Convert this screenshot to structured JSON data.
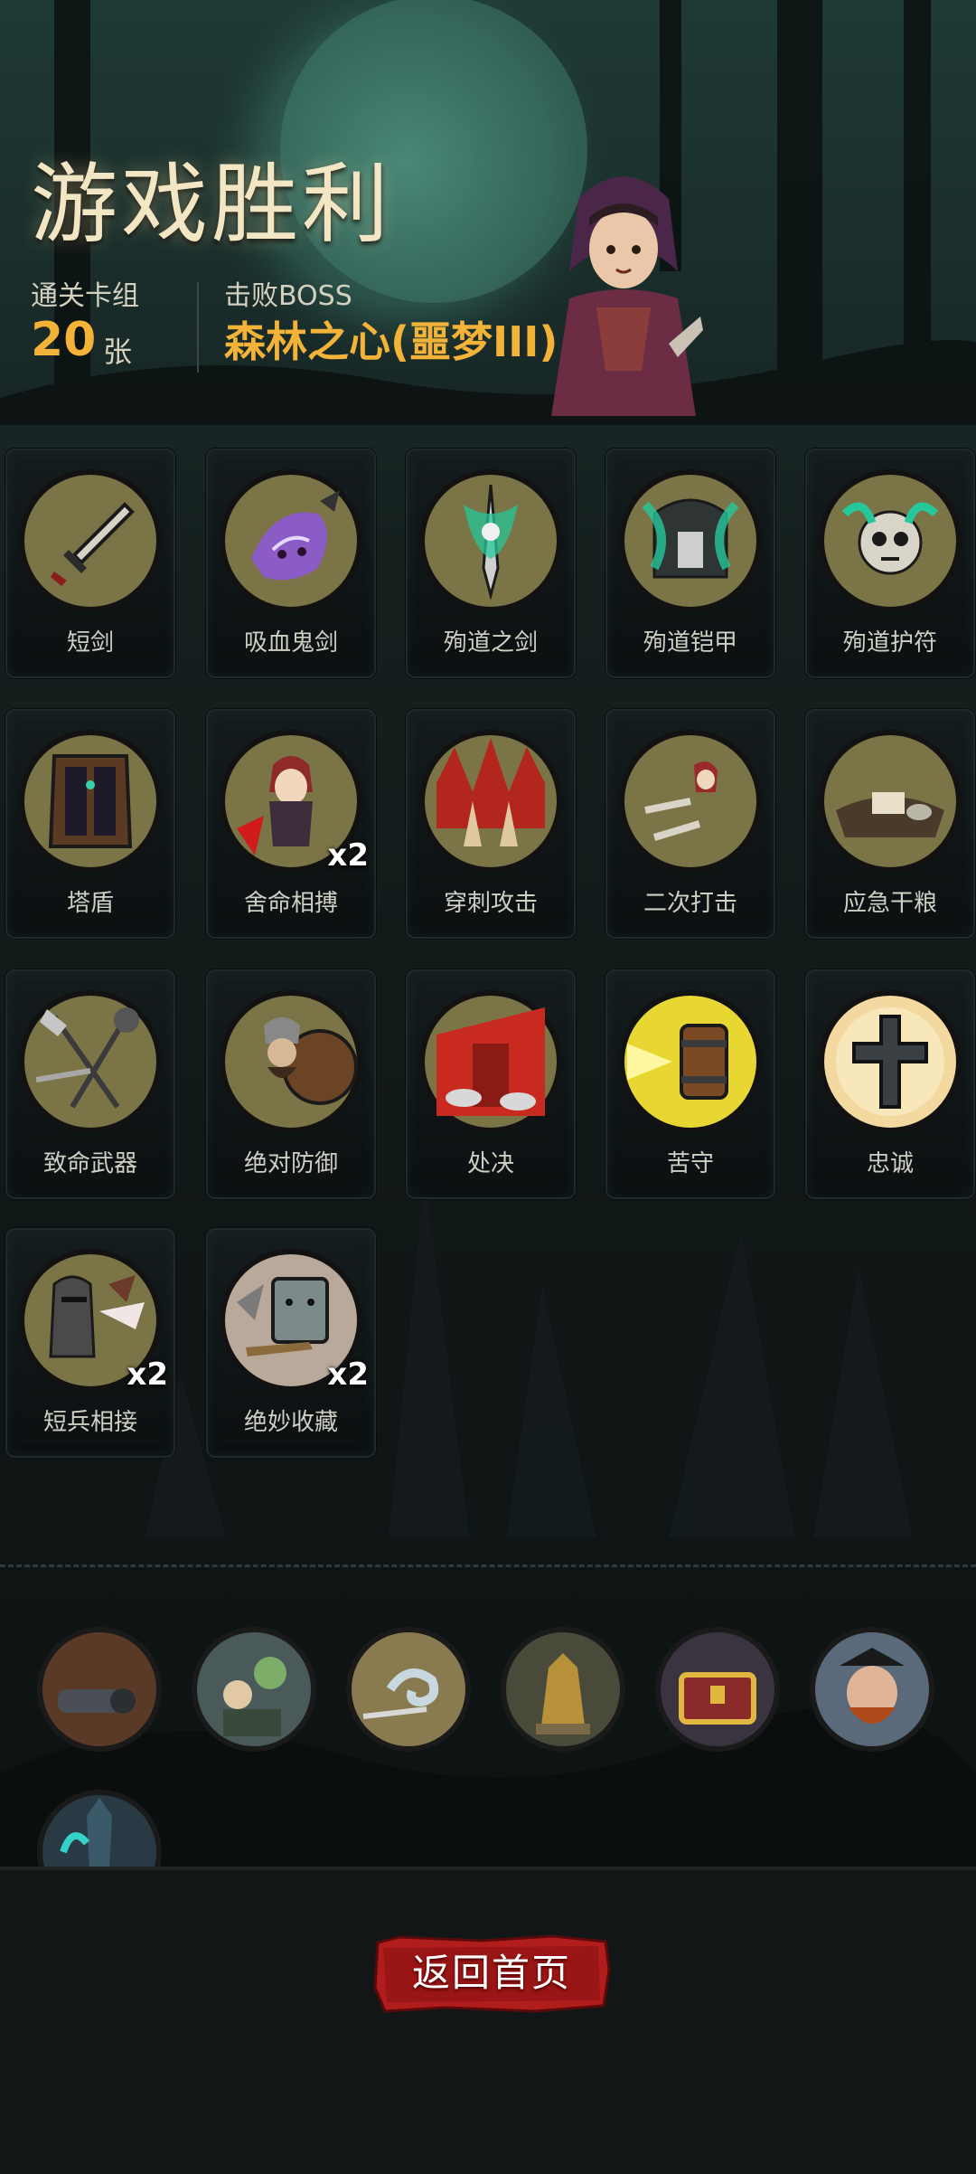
{
  "result": {
    "title": "游戏胜利",
    "deck_label": "通关卡组",
    "deck_count": "20",
    "deck_unit": "张",
    "boss_label": "击败BOSS",
    "boss_name": "森林之心(噩梦III)"
  },
  "cards": [
    {
      "name": "短剑",
      "multiplier": "",
      "icon": "dagger-icon"
    },
    {
      "name": "吸血鬼剑",
      "multiplier": "",
      "icon": "vampire-sword-icon"
    },
    {
      "name": "殉道之剑",
      "multiplier": "",
      "icon": "martyr-sword-icon"
    },
    {
      "name": "殉道铠甲",
      "multiplier": "",
      "icon": "martyr-armor-icon"
    },
    {
      "name": "殉道护符",
      "multiplier": "",
      "icon": "martyr-amulet-icon"
    },
    {
      "name": "塔盾",
      "multiplier": "",
      "icon": "tower-shield-icon"
    },
    {
      "name": "舍命相搏",
      "multiplier": "x2",
      "icon": "desperate-fight-icon"
    },
    {
      "name": "穿刺攻击",
      "multiplier": "",
      "icon": "pierce-attack-icon"
    },
    {
      "name": "二次打击",
      "multiplier": "",
      "icon": "double-strike-icon"
    },
    {
      "name": "应急干粮",
      "multiplier": "",
      "icon": "emergency-ration-icon"
    },
    {
      "name": "致命武器",
      "multiplier": "",
      "icon": "deadly-weapons-icon"
    },
    {
      "name": "绝对防御",
      "multiplier": "",
      "icon": "absolute-defense-icon"
    },
    {
      "name": "处决",
      "multiplier": "",
      "icon": "execute-icon"
    },
    {
      "name": "苦守",
      "multiplier": "",
      "icon": "hold-fast-icon"
    },
    {
      "name": "忠诚",
      "multiplier": "",
      "icon": "loyalty-cross-icon"
    },
    {
      "name": "短兵相接",
      "multiplier": "x2",
      "icon": "close-combat-icon"
    },
    {
      "name": "绝妙收藏",
      "multiplier": "x2",
      "icon": "fine-collection-icon"
    }
  ],
  "relics": [
    {
      "icon": "cannon-relic-icon"
    },
    {
      "icon": "zombie-scholar-relic-icon"
    },
    {
      "icon": "wind-swirl-relic-icon"
    },
    {
      "icon": "golden-statue-relic-icon"
    },
    {
      "icon": "treasure-chest-relic-icon"
    },
    {
      "icon": "pirate-relic-icon"
    },
    {
      "icon": "crystal-relic-icon"
    }
  ],
  "actions": {
    "home_label": "返回首页"
  },
  "colors": {
    "accent_gold": "#f2b338",
    "button_red": "#b11d1d",
    "background": "#0f1314"
  }
}
